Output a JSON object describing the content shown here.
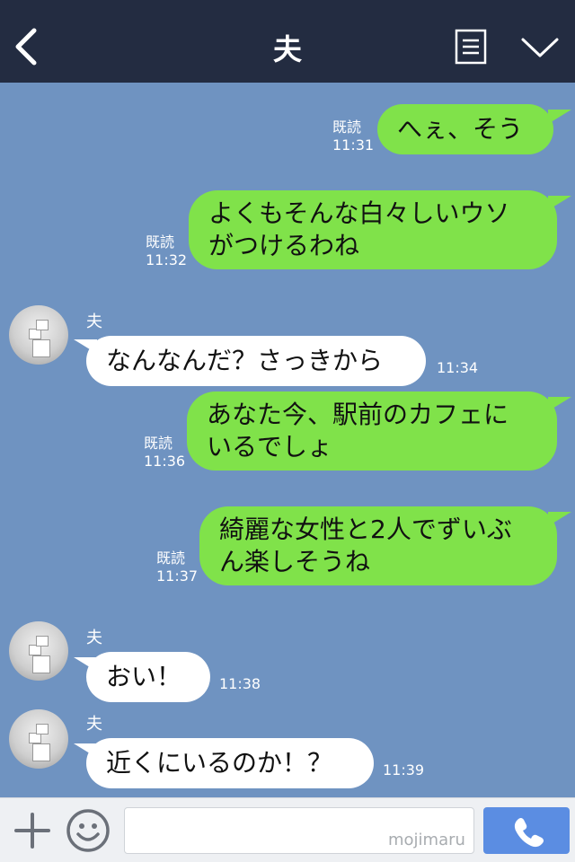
{
  "header": {
    "title": "夫",
    "back_icon": "chevron-left-icon",
    "menu_icon": "document-icon",
    "more_icon": "chevron-down-icon"
  },
  "messages": [
    {
      "side": "me",
      "text_lines": [
        "へぇ、そう"
      ],
      "read": "既読",
      "time": "11:31"
    },
    {
      "side": "me",
      "text_lines": [
        "よくもそんな白々しいウソ",
        "がつけるわね"
      ],
      "read": "既読",
      "time": "11:32"
    },
    {
      "side": "them",
      "sender": "夫",
      "text_lines": [
        "なんなんだ？さっきから"
      ],
      "time": "11:34"
    },
    {
      "side": "me",
      "text_lines": [
        "あなた今、駅前のカフェに",
        "いるでしょ"
      ],
      "read": "既読",
      "time": "11:36"
    },
    {
      "side": "me",
      "text_lines": [
        "綺麗な女性と2人でずいぶ",
        "ん楽しそうね"
      ],
      "read": "既読",
      "time": "11:37"
    },
    {
      "side": "them",
      "sender": "夫",
      "text_lines": [
        "おい！"
      ],
      "time": "11:38"
    },
    {
      "side": "them",
      "sender": "夫",
      "text_lines": [
        "近くにいるのか！？"
      ],
      "time": "11:39"
    }
  ],
  "footer": {
    "input_value": "",
    "watermark": "mojimaru",
    "plus_icon": "plus-icon",
    "emoji_icon": "smiley-icon",
    "call_icon": "phone-icon"
  },
  "colors": {
    "header_bg": "#232c41",
    "chat_bg": "#6f93c1",
    "my_bubble": "#80e24a",
    "their_bubble": "#ffffff",
    "call_button": "#5b8de2"
  }
}
